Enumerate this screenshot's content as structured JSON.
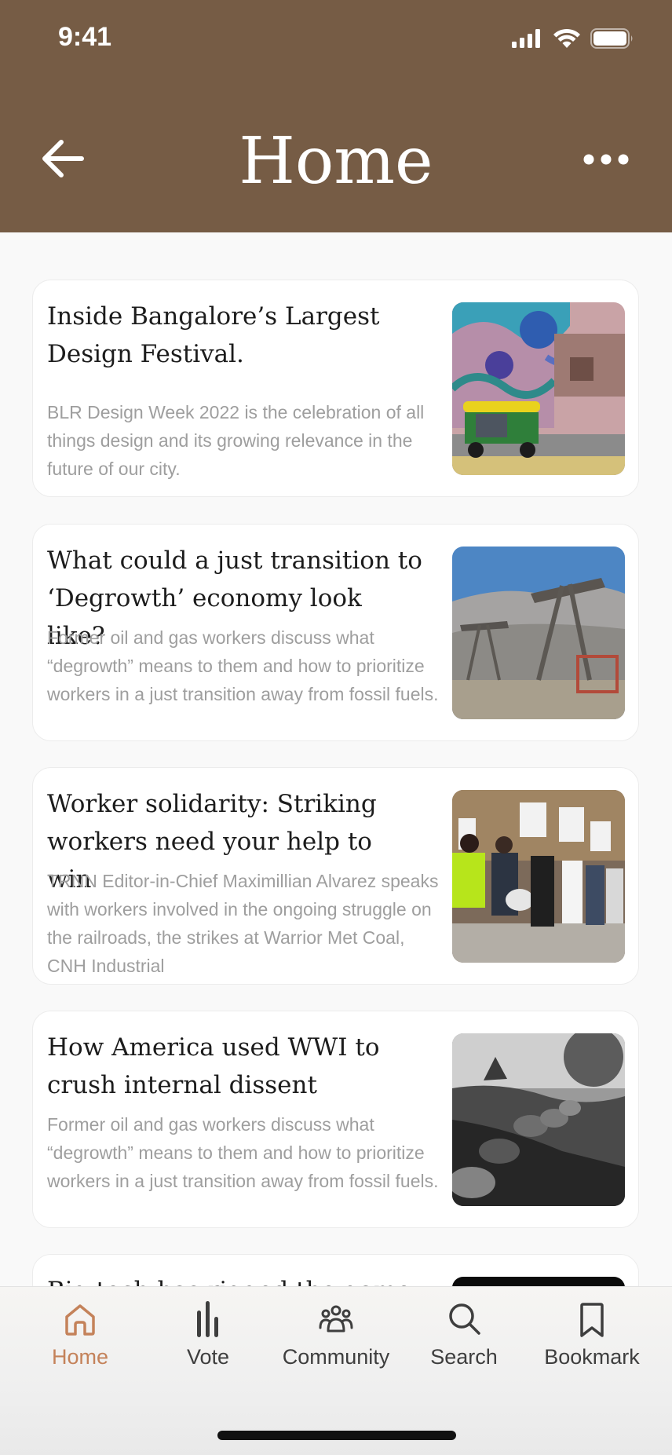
{
  "status_bar": {
    "time": "9:41"
  },
  "header": {
    "title": "Home",
    "background": "#765c45"
  },
  "articles": [
    {
      "title": "Inside Bangalore’s Largest Design Festival.",
      "description": "BLR Design Week 2022 is the celebration of all things design and its growing relevance in the future of our city.",
      "image": "mural-autorickshaw-photo"
    },
    {
      "title": "What could a just transition to ‘Degrowth’ economy look like?",
      "description": "Former oil and gas workers discuss what “degrowth” means to them and how to prioritize workers in a just transition away from fossil fuels.",
      "image": "oil-pumpjacks-photo"
    },
    {
      "title": "Worker solidarity: Striking workers need your help to win",
      "description": "TRNN Editor-in-Chief Maximillian Alvarez speaks with workers involved in the ongoing struggle on the railroads, the strikes at Warrior Met Coal, CNH Industrial",
      "image": "strike-march-photo"
    },
    {
      "title": "How America used WWI to crush internal dissent",
      "description": "Former oil and gas workers discuss what “degrowth” means to them and how to prioritize workers in a just transition away from fossil fuels.",
      "image": "wwi-trench-photo"
    },
    {
      "title": "Big tech has rigged the game",
      "description": "",
      "image": "dark-photo"
    }
  ],
  "tabbar": {
    "active_color": "#c4825a",
    "tabs": [
      {
        "label": "Home",
        "icon": "home-icon",
        "active": true
      },
      {
        "label": "Vote",
        "icon": "vote-bars-icon",
        "active": false
      },
      {
        "label": "Community",
        "icon": "community-icon",
        "active": false
      },
      {
        "label": "Search",
        "icon": "search-icon",
        "active": false
      },
      {
        "label": "Bookmark",
        "icon": "bookmark-icon",
        "active": false
      }
    ]
  }
}
